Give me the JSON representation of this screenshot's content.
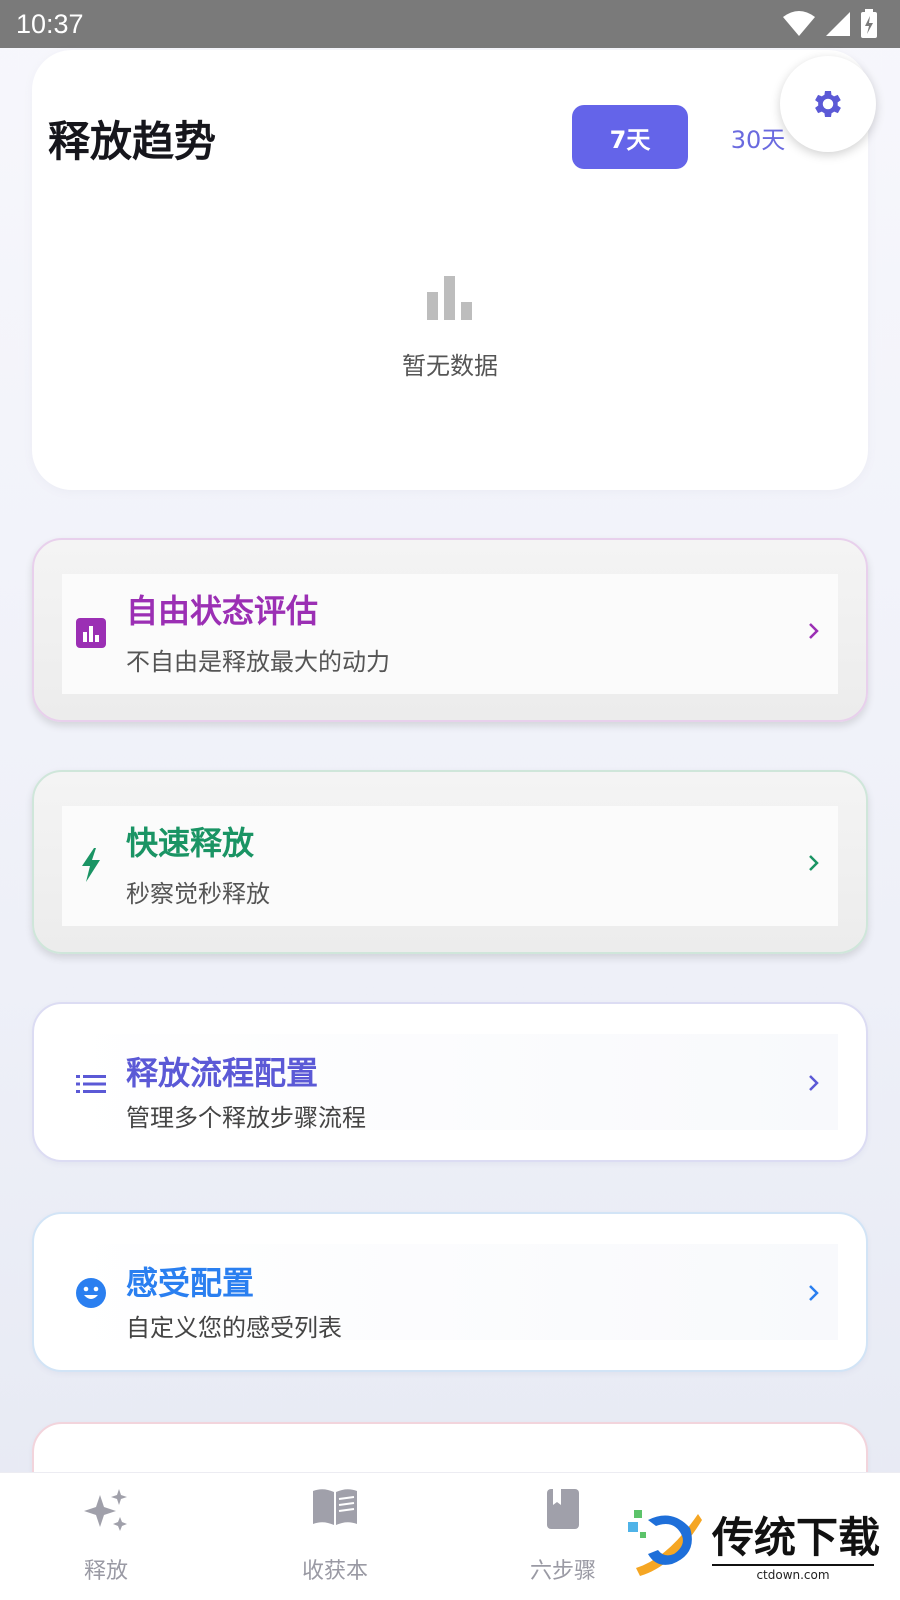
{
  "status_bar": {
    "time": "10:37"
  },
  "trend": {
    "title": "释放趋势",
    "range_7": "7天",
    "range_30": "30天",
    "empty_text": "暂无数据"
  },
  "menu": [
    {
      "title": "自由状态评估",
      "subtitle": "不自由是释放最大的动力",
      "color": "#9b2fb4",
      "icon": "bar-chart-icon"
    },
    {
      "title": "快速释放",
      "subtitle": "秒察觉秒释放",
      "color": "#1a9464",
      "icon": "lightning-icon"
    },
    {
      "title": "释放流程配置",
      "subtitle": "管理多个释放步骤流程",
      "color": "#5b59d6",
      "icon": "list-icon"
    },
    {
      "title": "感受配置",
      "subtitle": "自定义您的感受列表",
      "color": "#2a7ff0",
      "icon": "smiley-icon"
    }
  ],
  "bottom_nav": [
    {
      "label": "释放",
      "icon": "sparkle-icon"
    },
    {
      "label": "收获本",
      "icon": "open-book-icon"
    },
    {
      "label": "六步骤",
      "icon": "bookmark-book-icon"
    }
  ],
  "watermark": {
    "brand": "传统下载",
    "site": "ctdown.com"
  },
  "colors": {
    "accent": "#6464e9",
    "nav_inactive": "#9a9aa4"
  }
}
